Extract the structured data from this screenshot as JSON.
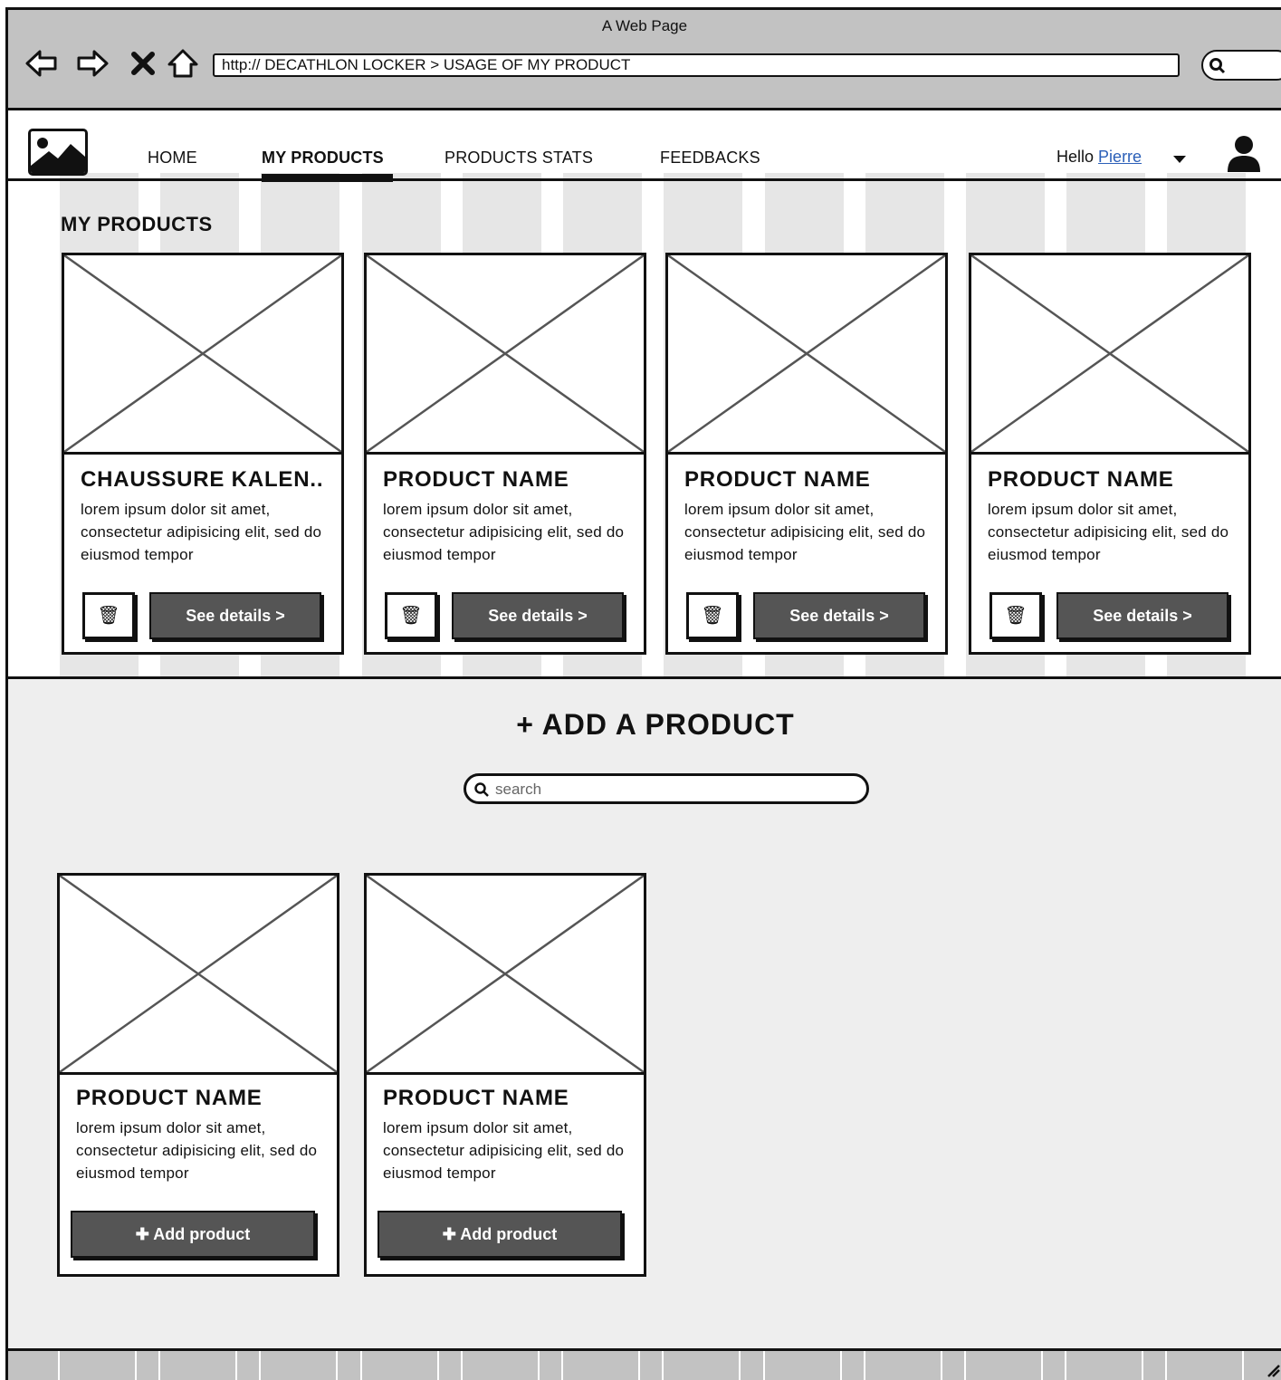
{
  "window": {
    "title": "A Web Page"
  },
  "browser": {
    "url": "http:// DECATHLON LOCKER > USAGE OF MY PRODUCT"
  },
  "nav": {
    "items": [
      {
        "label": "HOME",
        "active": false
      },
      {
        "label": "MY PRODUCTS",
        "active": true
      },
      {
        "label": "PRODUCTS STATS",
        "active": false
      },
      {
        "label": "FEEDBACKS",
        "active": false
      }
    ],
    "greeting": "Hello",
    "user_name": "Pierre"
  },
  "my_products": {
    "title": "MY PRODUCTS",
    "cards": [
      {
        "name": "CHAUSSURE KALEN..",
        "description": "lorem ipsum dolor sit amet, consectetur adipisicing elit, sed do eiusmod tempor",
        "details_label": "See details >"
      },
      {
        "name": "PRODUCT NAME",
        "description": "lorem ipsum dolor sit amet, consectetur adipisicing elit, sed do eiusmod tempor",
        "details_label": "See details >"
      },
      {
        "name": "PRODUCT NAME",
        "description": "lorem ipsum dolor sit amet, consectetur adipisicing elit, sed do eiusmod tempor",
        "details_label": "See details >"
      },
      {
        "name": "PRODUCT NAME",
        "description": "lorem ipsum dolor sit amet, consectetur adipisicing elit, sed do eiusmod tempor",
        "details_label": "See details >"
      }
    ]
  },
  "add_product": {
    "title": "+ ADD A PRODUCT",
    "search_placeholder": "search",
    "cards": [
      {
        "name": "PRODUCT NAME",
        "description": "lorem ipsum dolor sit amet, consectetur adipisicing elit, sed do eiusmod tempor",
        "add_label": "Add product"
      },
      {
        "name": "PRODUCT NAME",
        "description": "lorem ipsum dolor sit amet, consectetur adipisicing elit, sed do eiusmod tempor",
        "add_label": "Add product"
      }
    ]
  }
}
